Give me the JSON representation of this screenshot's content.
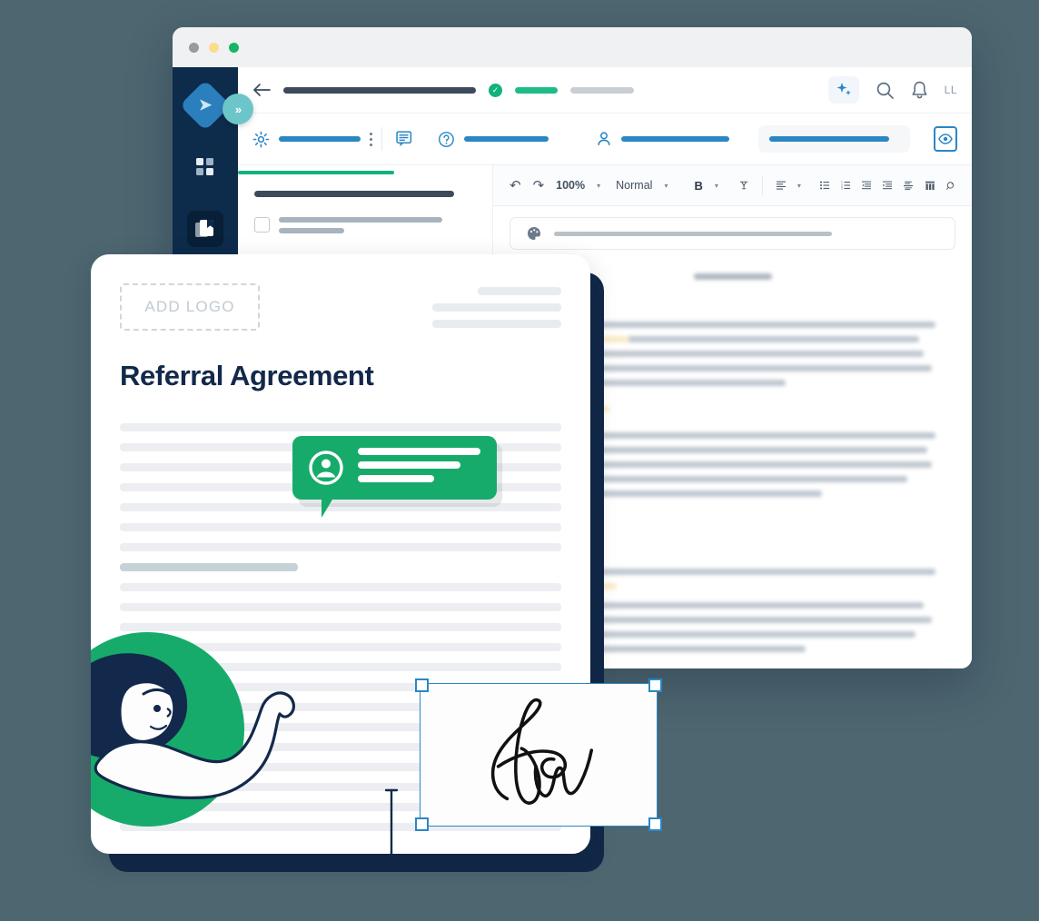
{
  "background_color": "#4d6670",
  "window": {
    "traffic_lights": [
      "close-grey",
      "minimize-amber",
      "maximize-green"
    ],
    "sidebar": {
      "logo_glyph": "➤",
      "items": [
        {
          "name": "app-logo",
          "label": ""
        },
        {
          "name": "dashboard",
          "label": ""
        },
        {
          "name": "documents",
          "label": "",
          "active": true
        },
        {
          "name": "company",
          "label": ""
        },
        {
          "name": "tasks",
          "label": ""
        }
      ],
      "expand_button_label": "»"
    },
    "topbar": {
      "back_icon": "arrow-left-icon",
      "status_check": "✓",
      "ai_icon": "sparkle-icon",
      "search_icon": "search-icon",
      "bell_icon": "bell-icon",
      "avatar_initials": "LL"
    },
    "toolbar_secondary": {
      "settings_icon": "gear-icon",
      "kebab_icon": "more-vertical-icon",
      "comment_icon": "comment-icon",
      "help_icon": "help-circle-icon",
      "person_icon": "person-icon",
      "preview_icon": "eye-icon"
    },
    "editor_toolbar": {
      "undo_label": "↶",
      "redo_label": "↷",
      "zoom_value": "100%",
      "style_value": "Normal",
      "bold_label": "B",
      "clear_format_icon": "clear-formatting-icon",
      "align_icon": "align-left-icon",
      "bullet_list_icon": "bullet-list-icon",
      "numbered_list_icon": "numbered-list-icon",
      "outdent_icon": "outdent-icon",
      "indent_icon": "indent-icon",
      "page_break_icon": "page-break-icon",
      "table_icon": "table-icon",
      "find_icon": "find-replace-icon",
      "caret_label": "▾",
      "color_picker_icon": "palette-icon"
    }
  },
  "document": {
    "logo_placeholder": "ADD LOGO",
    "title": "Referral Agreement",
    "comment_bubble": {
      "avatar_icon": "user-avatar-icon",
      "line_count": 3
    },
    "text_cursor_icon": "text-caret-icon",
    "signature": {
      "selected": true,
      "handle_color": "#2a87c4",
      "alt": "handwritten-signature"
    },
    "illustration": {
      "alt": "woman-with-arm-illustration",
      "circle_color": "#17ab6b",
      "hair_color": "#13294b"
    },
    "body_line_widths": [
      "100%",
      "100%",
      "100%",
      "100%",
      "100%",
      "100%"
    ],
    "selection_highlight_color": "#c6d2d8"
  },
  "colors": {
    "sidebar": "#0d2b4b",
    "green": "#17ab6b",
    "blue": "#2a87c4",
    "teal": "#6cc6c9",
    "navy": "#13294b",
    "highlight_yellow": "#f5dfa4"
  }
}
